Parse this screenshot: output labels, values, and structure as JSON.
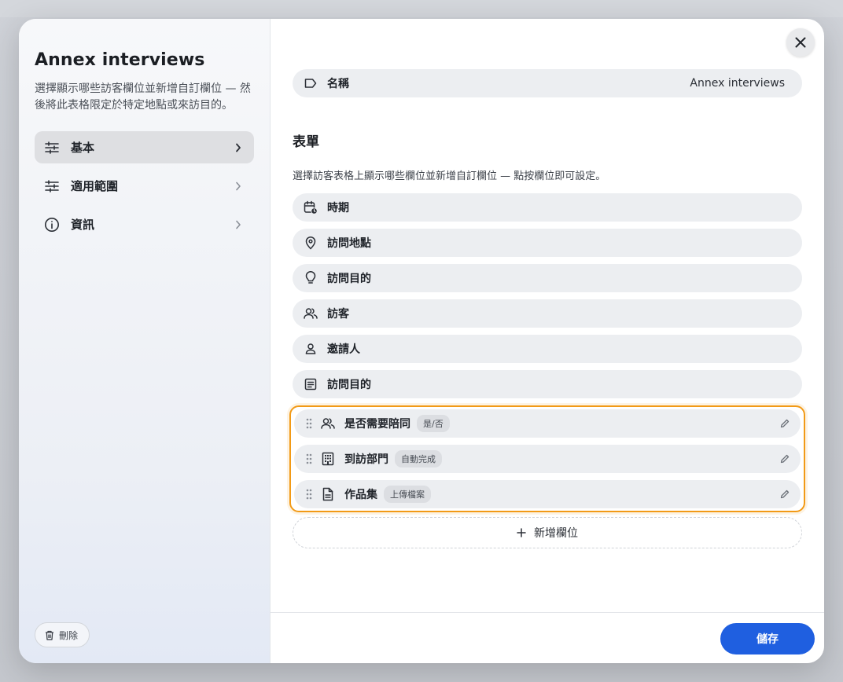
{
  "sidebar": {
    "title": "Annex interviews",
    "description": "選擇顯示哪些訪客欄位並新增自訂欄位 — 然後將此表格限定於特定地點或來訪目的。",
    "items": [
      {
        "label": "基本",
        "icon": "sliders-icon",
        "active": true
      },
      {
        "label": "適用範圍",
        "icon": "sliders-icon",
        "active": false
      },
      {
        "label": "資訊",
        "icon": "info-icon",
        "active": false
      }
    ],
    "delete_label": "刪除"
  },
  "name_field": {
    "label": "名稱",
    "value": "Annex interviews",
    "icon": "tag-icon"
  },
  "form": {
    "title": "表單",
    "description": "選擇訪客表格上顯示哪些欄位並新增自訂欄位 — 點按欄位即可設定。",
    "fields": [
      {
        "label": "時期",
        "icon": "calendar-clock-icon"
      },
      {
        "label": "訪問地點",
        "icon": "location-pin-icon"
      },
      {
        "label": "訪問目的",
        "icon": "lightbulb-icon"
      },
      {
        "label": "訪客",
        "icon": "users-icon"
      },
      {
        "label": "邀請人",
        "icon": "user-icon"
      },
      {
        "label": "訪問目的",
        "icon": "document-lines-icon"
      }
    ],
    "custom_fields": [
      {
        "label": "是否需要陪同",
        "badge": "是/否",
        "icon": "users-icon"
      },
      {
        "label": "到訪部門",
        "badge": "自動完成",
        "icon": "building-icon"
      },
      {
        "label": "作品集",
        "badge": "上傳檔案",
        "icon": "file-icon"
      }
    ],
    "add_field_label": "新增欄位"
  },
  "footer": {
    "save_label": "儲存"
  },
  "colors": {
    "accent": "#1f5fe0",
    "highlight": "#f29a16"
  }
}
